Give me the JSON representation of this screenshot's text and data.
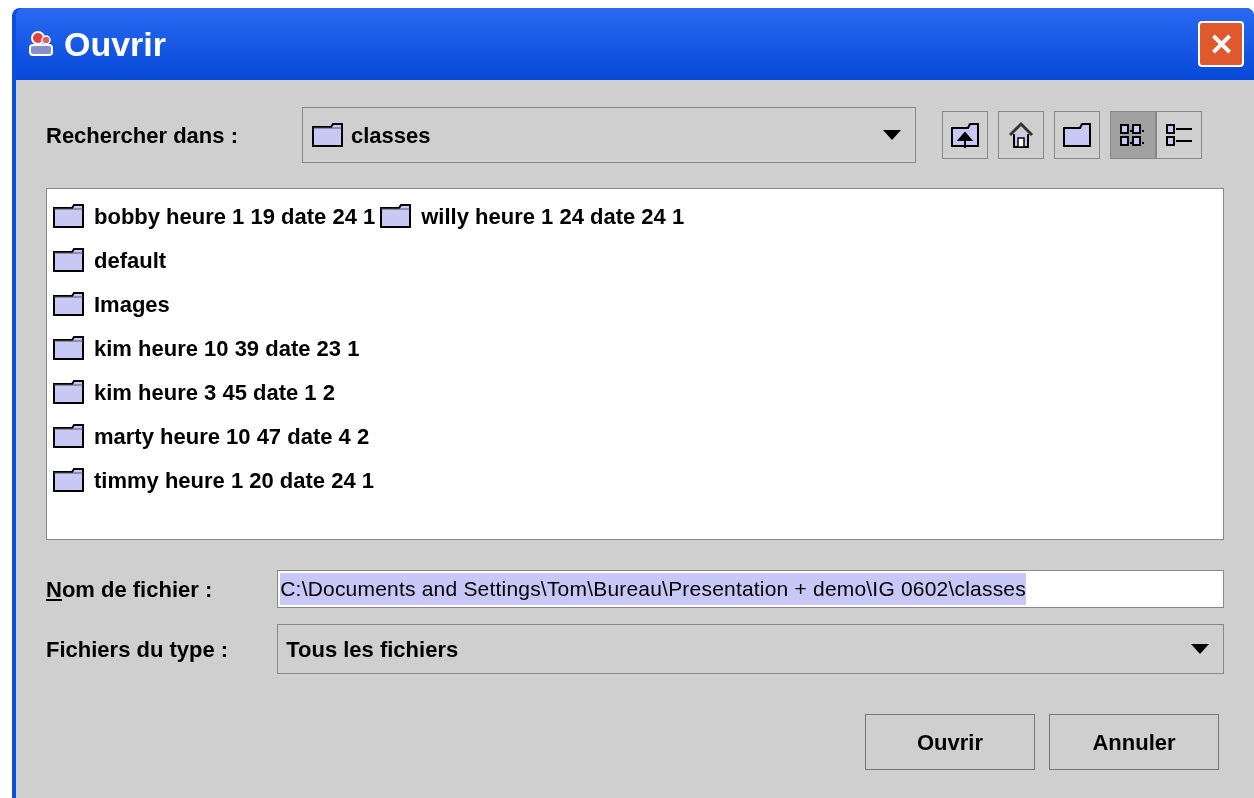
{
  "window": {
    "title": "Ouvrir",
    "close": "✕"
  },
  "look_in": {
    "label": "Rechercher dans :",
    "value": "classes"
  },
  "toolbar": [
    {
      "kind": "up",
      "selected": false
    },
    {
      "kind": "home",
      "selected": false
    },
    {
      "kind": "newfolder",
      "selected": false
    },
    {
      "kind": "list",
      "selected": true
    },
    {
      "kind": "details",
      "selected": false
    }
  ],
  "file_list": {
    "columns": [
      {
        "items": [
          "bobby heure 1 19 date 24 1",
          "default",
          "Images",
          "kim heure 10 39 date 23 1",
          "kim heure 3 45 date 1 2",
          "marty heure 10 47 date 4 2",
          "timmy heure 1 20 date 24 1"
        ]
      },
      {
        "items": [
          "willy heure 1 24 date 24 1"
        ]
      }
    ]
  },
  "file_name": {
    "label": "Nom de fichier :",
    "underline_first": true,
    "value": "C:\\Documents and Settings\\Tom\\Bureau\\Presentation + demo\\IG 0602\\classes",
    "text_selected": true
  },
  "file_type": {
    "label": "Fichiers du type :",
    "value": "Tous les fichiers"
  },
  "buttons": [
    "Ouvrir",
    "Annuler"
  ]
}
